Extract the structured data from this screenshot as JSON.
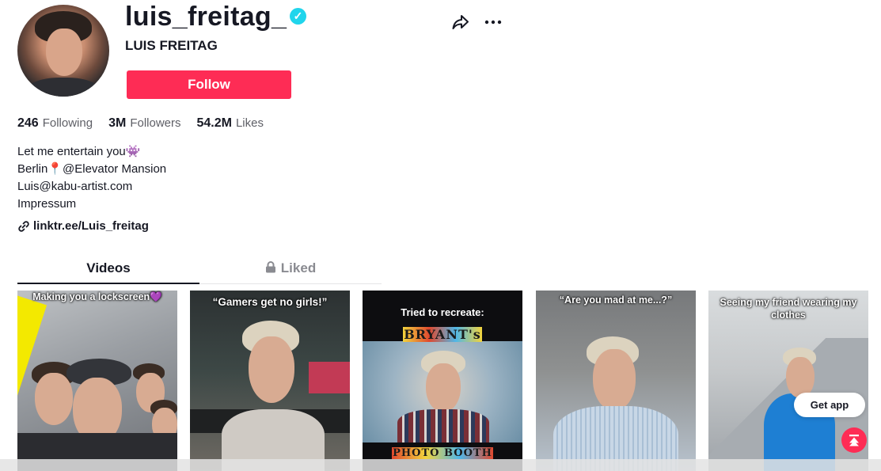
{
  "profile": {
    "username": "luis_freitag_",
    "display_name": "LUIS FREITAG",
    "verified_icon": "verified-check-icon",
    "follow_label": "Follow",
    "accent_color": "#fe2c55",
    "verified_color": "#20d5ec"
  },
  "actions": {
    "share_icon": "share-arrow-icon",
    "more_icon": "more-horizontal-icon"
  },
  "stats": {
    "following_count": "246",
    "following_label": "Following",
    "followers_count": "3M",
    "followers_label": "Followers",
    "likes_count": "54.2M",
    "likes_label": "Likes"
  },
  "bio": {
    "line1": "Let me entertain you👾",
    "line2": "Berlin📍@Elevator Mansion",
    "line3": "Luis@kabu-artist.com",
    "line4": "Impressum",
    "link": "linktr.ee/Luis_freitag",
    "link_icon": "link-icon"
  },
  "tabs": {
    "videos": "Videos",
    "liked": "Liked",
    "liked_icon": "lock-icon"
  },
  "videos": [
    {
      "caption": "Making you a lockscreen💜"
    },
    {
      "caption": "“Gamers get no girls!”"
    },
    {
      "caption": "Tried to recreate:",
      "overlay_top": "BRYANT's",
      "overlay_bottom": "PHOTO BOOTH"
    },
    {
      "caption": "“Are you mad at me...?”"
    },
    {
      "caption": "Seeing my friend wearing my clothes"
    }
  ],
  "floating": {
    "get_app": "Get app",
    "scroll_top_icon": "arrow-up-to-top-icon"
  }
}
